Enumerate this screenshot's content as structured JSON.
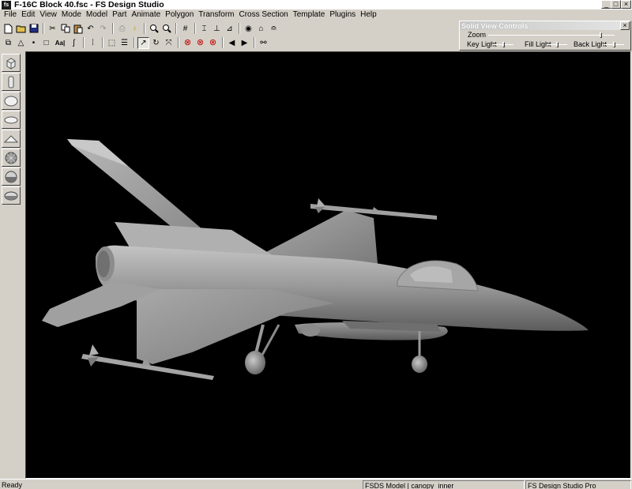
{
  "window": {
    "icon_text": "fs",
    "title": "F-16C Block 40.fsc - FS Design Studio",
    "minimize": "_",
    "maximize": "□",
    "close": "×"
  },
  "menu": [
    "File",
    "Edit",
    "View",
    "Mode",
    "Model",
    "Part",
    "Animate",
    "Polygon",
    "Transform",
    "Cross Section",
    "Template",
    "Plugins",
    "Help"
  ],
  "toolbar1": {
    "icons": [
      "new-file-icon",
      "open-folder-icon",
      "save-disk-icon",
      "cut-icon",
      "copy-icon",
      "paste-icon",
      "undo-icon",
      "redo-icon",
      "print-icon",
      "help-bulb-icon",
      "zoom-in-icon",
      "zoom-out-icon",
      "grid-icon",
      "axis-x-icon",
      "axis-y-icon",
      "axis-z-icon",
      "eye-view-icon",
      "house-icon",
      "terrain-icon"
    ]
  },
  "toolbar2": {
    "text_button": "Aa|",
    "icons": [
      "select-icon",
      "triangle-icon",
      "point-icon",
      "square-icon",
      "text-icon",
      "sum-icon",
      "grid-dots-icon",
      "select-rect-icon",
      "lines-icon",
      "arrow-curve-icon",
      "rotate-icon",
      "scale-icon",
      "no-entry-1-icon",
      "no-entry-2-icon",
      "no-entry-3-icon",
      "prev-icon",
      "next-icon",
      "binoculars-icon"
    ]
  },
  "solid_view": {
    "title": "Solid View Controls",
    "close": "×",
    "zoom_label": "Zoom",
    "key_light_label": "Key Light",
    "fill_light_label": "Fill Light",
    "back_light_label": "Back Light",
    "zoom_value": 0.9,
    "key_light_value": 0.5,
    "fill_light_value": 0.5,
    "back_light_value": 0.5
  },
  "palette": [
    "cube-icon",
    "cylinder-icon",
    "sphere-icon",
    "disc-icon",
    "cone-icon",
    "geosphere-icon",
    "hemisphere-icon",
    "ellipsoid-icon"
  ],
  "statusbar": {
    "ready": "Ready",
    "model_part": "FSDS Model | canopy_inner",
    "product": "FS Design Studio Pro"
  },
  "colors": {
    "viewport_bg": "#000000",
    "model_light": "#b4b4b4",
    "model_mid": "#8c8c8c",
    "model_dark": "#5a5a5a",
    "chrome": "#d4d0c8"
  }
}
